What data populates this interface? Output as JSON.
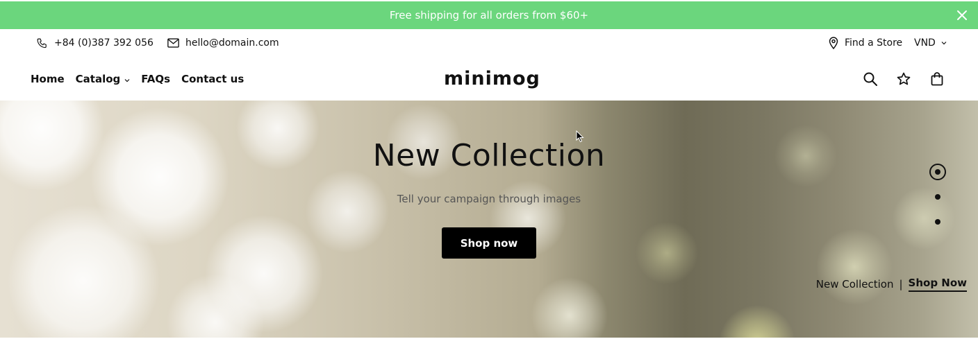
{
  "announcement": {
    "text": "Free shipping for all orders from $60+",
    "bg_color": "#6bd67d",
    "close_icon": "close-icon"
  },
  "topbar": {
    "phone": "+84 (0)387 392 056",
    "email": "hello@domain.com",
    "store_label": "Find a Store",
    "currency": "VND"
  },
  "header": {
    "nav": [
      {
        "label": "Home"
      },
      {
        "label": "Catalog"
      },
      {
        "label": "FAQs"
      },
      {
        "label": "Contact us"
      }
    ],
    "logo": "minimog",
    "icons": [
      "search-icon",
      "star-icon",
      "bag-icon"
    ]
  },
  "hero": {
    "title": "New Collection",
    "subtitle": "Tell your campaign through images",
    "button": "Shop now",
    "caption_left": "New Collection",
    "caption_sep": "|",
    "caption_right": "Shop Now",
    "slide_count": 3,
    "active_slide": 1
  }
}
